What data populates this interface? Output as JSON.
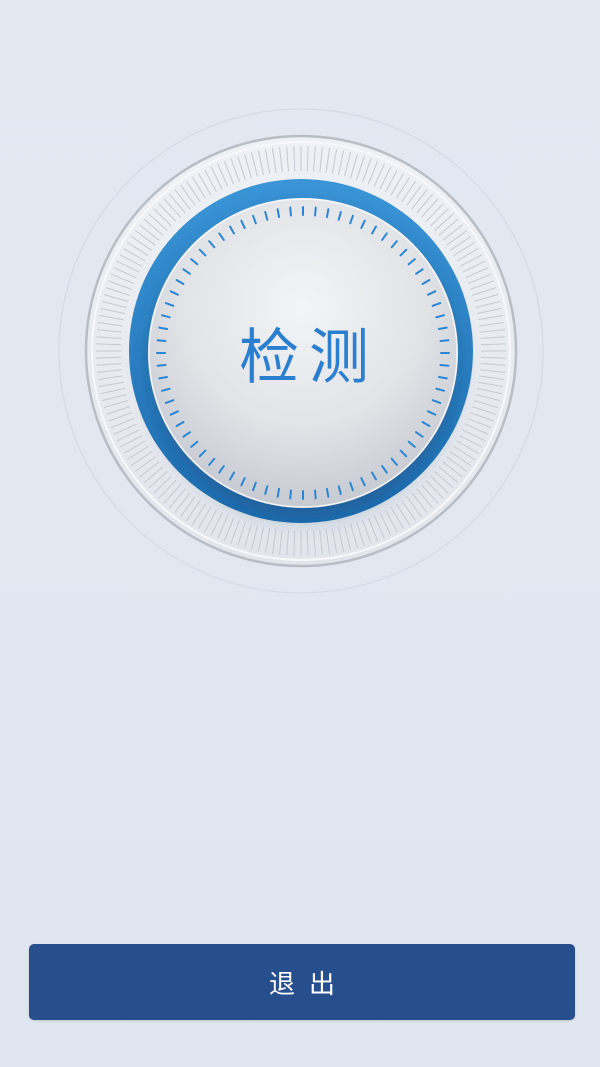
{
  "detect_button": {
    "label": "检测"
  },
  "exit_button": {
    "label": "退出"
  },
  "colors": {
    "background": "#e0e7f0",
    "accent_blue": "#2a7fd0",
    "ring_blue": "#2e86c8",
    "exit_button": "#284f8d",
    "exit_text": "#ffffff"
  },
  "icons": {
    "dial": "scan-dial-icon"
  }
}
